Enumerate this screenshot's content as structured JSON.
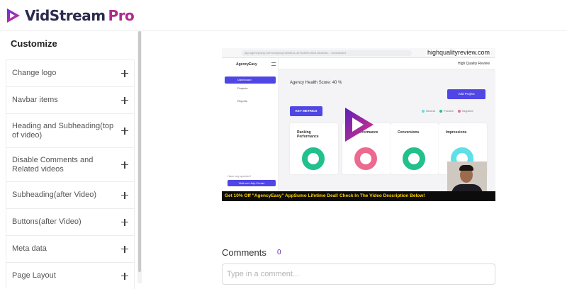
{
  "brand": {
    "name": "VidStream",
    "suffix": "Pro",
    "logo_icon": "play-triangle-logo"
  },
  "sidebar": {
    "title": "Customize",
    "items": [
      {
        "label": "Change logo"
      },
      {
        "label": "Navbar items"
      },
      {
        "label": "Heading and Subheading(top of video)"
      },
      {
        "label": "Disable Comments and Related videos"
      },
      {
        "label": "Subheading(after Video)"
      },
      {
        "label": "Buttons(after Video)"
      },
      {
        "label": "Meta data"
      },
      {
        "label": "Page Layout"
      }
    ]
  },
  "video": {
    "watermark": "highqualityreview.com",
    "url": "app.agencyeasy.com/company/1d6b81a-4d78-85f3-b6b3-8b4de6c... /Dashboard",
    "app_logo": "AgencyEasy",
    "nav": {
      "active": "Dashboard",
      "items": [
        "Projects",
        "Reports"
      ]
    },
    "help_text": "Have any queries?",
    "help_button": "Visit our Help Center",
    "header_user": "High Quality Review",
    "health_score": "Agency Health Score: 40 %",
    "add_project": "Add Project",
    "key_metrics": "KEY METRICS",
    "legend": [
      "Neutral",
      "Positive",
      "Negative"
    ],
    "metrics": [
      {
        "title": "Ranking Performance"
      },
      {
        "title": "Performance"
      },
      {
        "title": "Conversions"
      },
      {
        "title": "Impressions"
      }
    ],
    "promo": "Get 10% Off \"AgencyEasy\" AppSumo Lifetime Deal! Check In The Video Description Below!",
    "play_icon": "play-icon",
    "colors": {
      "accent": "#4f46e5",
      "green": "#22c08c",
      "pink": "#ec6a8f",
      "cyan": "#5ee0e8",
      "promo_text": "#ffd400"
    }
  },
  "comments": {
    "title": "Comments",
    "count": "0",
    "placeholder": "Type in a comment..."
  }
}
